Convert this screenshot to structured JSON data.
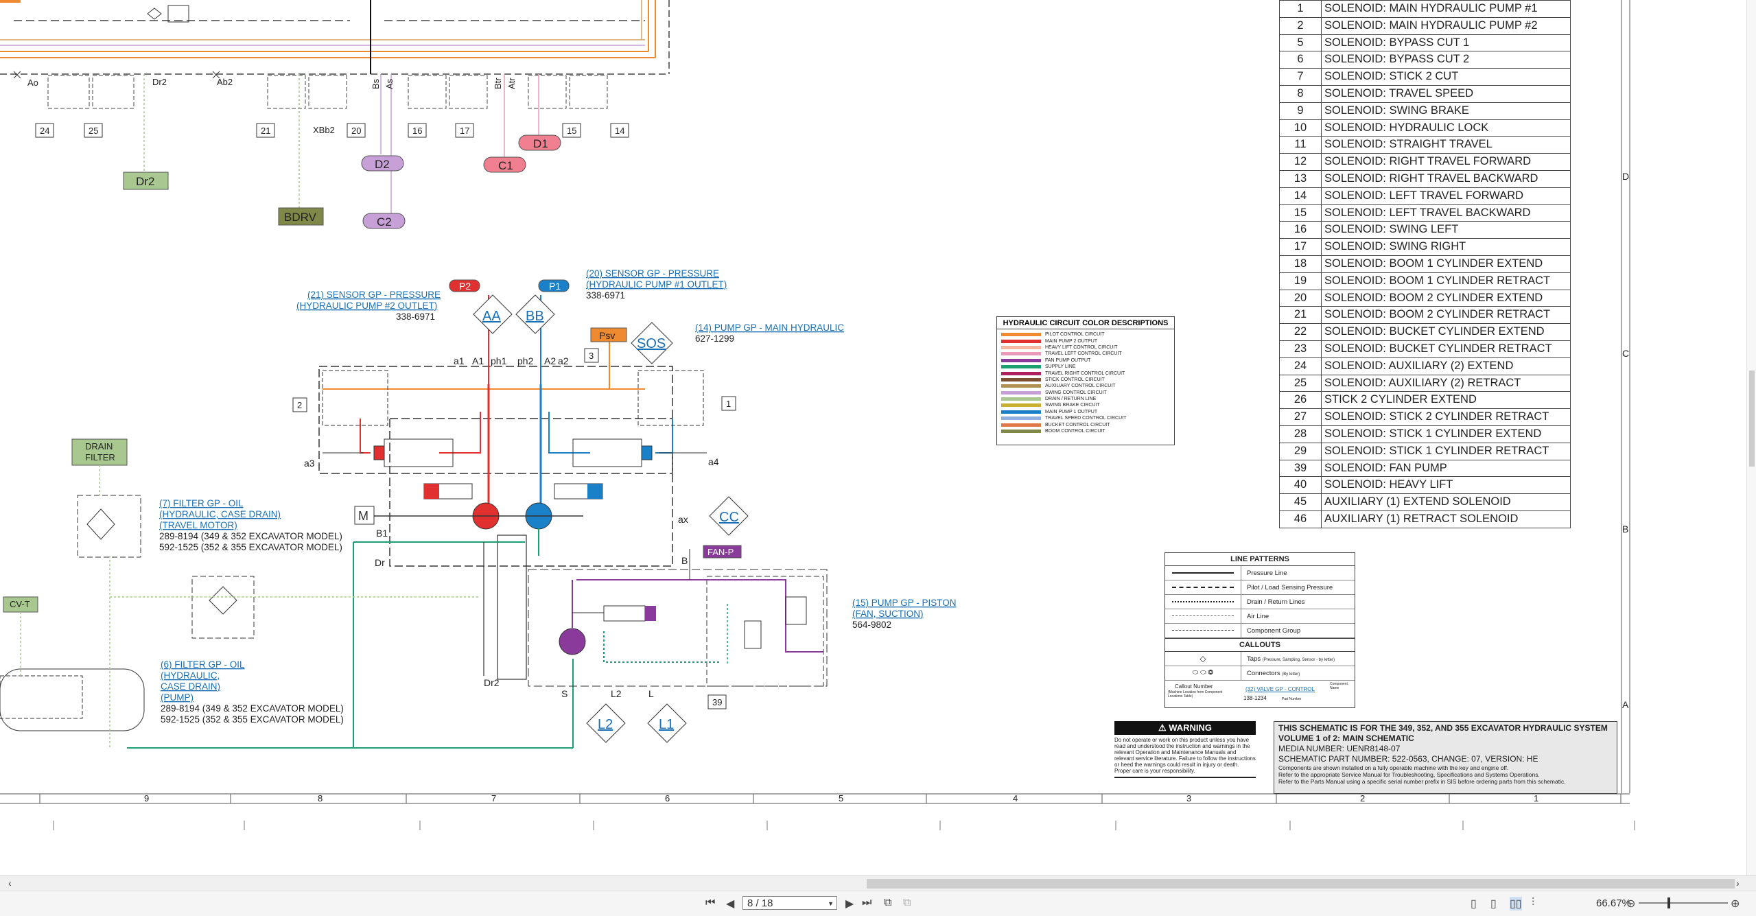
{
  "parts_table": [
    {
      "n": "1",
      "label": "SOLENOID: MAIN HYDRAULIC PUMP #1"
    },
    {
      "n": "2",
      "label": "SOLENOID: MAIN HYDRAULIC PUMP #2"
    },
    {
      "n": "5",
      "label": "SOLENOID: BYPASS CUT 1"
    },
    {
      "n": "6",
      "label": "SOLENOID: BYPASS CUT 2"
    },
    {
      "n": "7",
      "label": "SOLENOID: STICK 2 CUT"
    },
    {
      "n": "8",
      "label": "SOLENOID: TRAVEL SPEED"
    },
    {
      "n": "9",
      "label": "SOLENOID: SWING BRAKE"
    },
    {
      "n": "10",
      "label": "SOLENOID: HYDRAULIC LOCK"
    },
    {
      "n": "11",
      "label": "SOLENOID: STRAIGHT TRAVEL"
    },
    {
      "n": "12",
      "label": "SOLENOID: RIGHT TRAVEL FORWARD"
    },
    {
      "n": "13",
      "label": "SOLENOID: RIGHT TRAVEL BACKWARD"
    },
    {
      "n": "14",
      "label": "SOLENOID: LEFT TRAVEL FORWARD"
    },
    {
      "n": "15",
      "label": "SOLENOID: LEFT TRAVEL BACKWARD"
    },
    {
      "n": "16",
      "label": "SOLENOID: SWING LEFT"
    },
    {
      "n": "17",
      "label": "SOLENOID: SWING RIGHT"
    },
    {
      "n": "18",
      "label": "SOLENOID: BOOM 1 CYLINDER EXTEND"
    },
    {
      "n": "19",
      "label": "SOLENOID: BOOM 1 CYLINDER RETRACT"
    },
    {
      "n": "20",
      "label": "SOLENOID: BOOM 2 CYLINDER EXTEND"
    },
    {
      "n": "21",
      "label": "SOLENOID: BOOM 2 CYLINDER RETRACT"
    },
    {
      "n": "22",
      "label": "SOLENOID: BUCKET CYLINDER EXTEND"
    },
    {
      "n": "23",
      "label": "SOLENOID: BUCKET CYLINDER RETRACT"
    },
    {
      "n": "24",
      "label": "SOLENOID: AUXILIARY (2) EXTEND"
    },
    {
      "n": "25",
      "label": "SOLENOID: AUXILIARY (2) RETRACT"
    },
    {
      "n": "26",
      "label": "STICK 2 CYLINDER EXTEND"
    },
    {
      "n": "27",
      "label": "SOLENOID: STICK 2 CYLINDER RETRACT"
    },
    {
      "n": "28",
      "label": "SOLENOID: STICK 1 CYLINDER EXTEND"
    },
    {
      "n": "29",
      "label": "SOLENOID: STICK 1 CYLINDER RETRACT"
    },
    {
      "n": "39",
      "label": "SOLENOID: FAN PUMP"
    },
    {
      "n": "40",
      "label": "SOLENOID: HEAVY LIFT"
    },
    {
      "n": "45",
      "label": "AUXILIARY (1) EXTEND SOLENOID"
    },
    {
      "n": "46",
      "label": "AUXILIARY (1) RETRACT SOLENOID"
    }
  ],
  "color_legend": {
    "title": "HYDRAULIC CIRCUIT COLOR DESCRIPTIONS",
    "items": [
      {
        "label": "PILOT CONTROL CIRCUIT",
        "color": "#f08a30"
      },
      {
        "label": "MAIN PUMP 2 OUTPUT",
        "color": "#e03030"
      },
      {
        "label": "HEAVY LIFT CONTROL CIRCUIT",
        "color": "#f4b8a0"
      },
      {
        "label": "TRAVEL LEFT CONTROL CIRCUIT",
        "color": "#e89ab8"
      },
      {
        "label": "FAN PUMP OUTPUT",
        "color": "#8a3a9a"
      },
      {
        "label": "SUPPLY LINE",
        "color": "#1aa070"
      },
      {
        "label": "TRAVEL RIGHT CONTROL CIRCUIT",
        "color": "#b02060"
      },
      {
        "label": "STICK CONTROL CIRCUIT",
        "color": "#7a5030"
      },
      {
        "label": "AUXILIARY CONTROL CIRCUIT",
        "color": "#b09050"
      },
      {
        "label": "SWING CONTROL CIRCUIT",
        "color": "#c8a0d8"
      },
      {
        "label": "DRAIN / RETURN LINE",
        "color": "#a8c890"
      },
      {
        "label": "SWING BRAKE CIRCUIT",
        "color": "#c8b030"
      },
      {
        "label": "MAIN PUMP 1 OUTPUT",
        "color": "#1a80c8"
      },
      {
        "label": "TRAVEL SPEED CONTROL CIRCUIT",
        "color": "#90b0e0"
      },
      {
        "label": "BUCKET CONTROL CIRCUIT",
        "color": "#e07848"
      },
      {
        "label": "BOOM CONTROL CIRCUIT",
        "color": "#808848"
      }
    ]
  },
  "line_patterns": {
    "title": "LINE PATTERNS",
    "rows": [
      "Pressure Line",
      "Pilot / Load Sensing Pressure",
      "Drain / Return Lines",
      "Air Line",
      "Component Group"
    ],
    "callouts_title": "CALLOUTS",
    "taps_label": "Taps",
    "taps_note": "(Pressure, Sampling, Sensor - by letter)",
    "connectors_label": "Connectors",
    "connectors_note": "(By letter)",
    "callout_number_label": "Callout Number",
    "callout_number_note": "(Machine Location from Component Locations Table)",
    "callout_example": "(32) VALVE GP - CONTROL",
    "callout_part": "138-1234",
    "component_name": "Component Name",
    "part_number": "Part Number"
  },
  "warning": {
    "title": "WARNING",
    "body": "Do not operate or work on this product unless you have read and understood the instruction and warnings in the relevant Operation and Maintenance Manuals and relevant service literature. Failure to follow the instructions or heed the warnings could result in injury or death. Proper care is your responsibility."
  },
  "title_block": {
    "line1": "THIS SCHEMATIC IS FOR THE 349, 352, AND 355 EXCAVATOR HYDRAULIC SYSTEM",
    "line2": "VOLUME 1 of 2: MAIN SCHEMATIC",
    "line3": "MEDIA NUMBER: UENR8148-07",
    "line4": "SCHEMATIC PART NUMBER: 522-0563, CHANGE: 07, VERSION: HE",
    "note1": "Components are shown installed on a fully operable machine with the key and engine off.",
    "note2": "Refer to the appropriate Service Manual for Troubleshooting, Specifications and Systems Operations.",
    "note3": "Refer to the Parts Manual using a specific serial number prefix in SIS before ordering parts from this schematic."
  },
  "components": {
    "sensor21": [
      "(21) SENSOR GP - PRESSURE",
      "(HYDRAULIC PUMP #2 OUTLET)"
    ],
    "sensor21_pn": "338-6971",
    "sensor20": [
      "(20) SENSOR GP - PRESSURE",
      "(HYDRAULIC PUMP #1 OUTLET)"
    ],
    "sensor20_pn": "338-6971",
    "pump14": "(14) PUMP GP - MAIN HYDRAULIC",
    "pump14_pn": "627-1299",
    "filter7": [
      "(7) FILTER GP - OIL",
      "(HYDRAULIC, CASE DRAIN)",
      "(TRAVEL MOTOR)"
    ],
    "filter7_pn": [
      "289-8194 (349 & 352 EXCAVATOR MODEL)",
      "592-1525 (352 & 355 EXCAVATOR MODEL)"
    ],
    "filter6": [
      "(6) FILTER GP - OIL",
      "(HYDRAULIC,",
      "CASE DRAIN)",
      "(PUMP)"
    ],
    "filter6_pn": [
      "289-8194 (349 & 352 EXCAVATOR MODEL)",
      "592-1525 (352 & 355 EXCAVATOR MODEL)"
    ],
    "pump15": [
      "(15) PUMP GP - PISTON",
      "(FAN, SUCTION)"
    ],
    "pump15_pn": "564-9802"
  },
  "tags": {
    "P2": "P2",
    "P1": "P1",
    "Psv": "Psv",
    "AA": "AA",
    "BB": "BB",
    "SOS": "SOS",
    "CC": "CC",
    "L1": "L1",
    "L2": "L2",
    "FANP": "FAN-P",
    "D1": "D1",
    "D2": "D2",
    "C1": "C1",
    "C2": "C2",
    "Dr2": "Dr2",
    "BDRV": "BDRV",
    "DRAIN1": "DRAIN",
    "DRAIN2": "FILTER",
    "CVT": "CV-T",
    "M": "M"
  },
  "port_labels": {
    "a1": "a1",
    "A1": "A1",
    "ph1": "ph1",
    "ph2": "ph2",
    "A2": "A2",
    "a2": "a2",
    "a3": "a3",
    "a4": "a4",
    "B1": "B1",
    "Dr": "Dr",
    "ax": "ax",
    "B": "B",
    "S": "S",
    "L2": "L2",
    "L": "L",
    "Dr2b": "Dr2",
    "Ao": "Ao",
    "Dr2t": "Dr2",
    "Ab2": "Ab2",
    "XBb2": "XBb2",
    "Bs": "Bs",
    "As": "As",
    "Btr": "Btr",
    "Atr": "Atr"
  },
  "numbered_boxes": [
    "24",
    "25",
    "21",
    "20",
    "16",
    "17",
    "15",
    "14",
    "2",
    "1",
    "3",
    "39"
  ],
  "grid_columns": [
    "9",
    "8",
    "7",
    "6",
    "5",
    "4",
    "3",
    "2",
    "1"
  ],
  "grid_rows": [
    "D",
    "C",
    "B",
    "A"
  ],
  "viewer": {
    "page_value": "8 / 18",
    "zoom": "66.67%"
  }
}
